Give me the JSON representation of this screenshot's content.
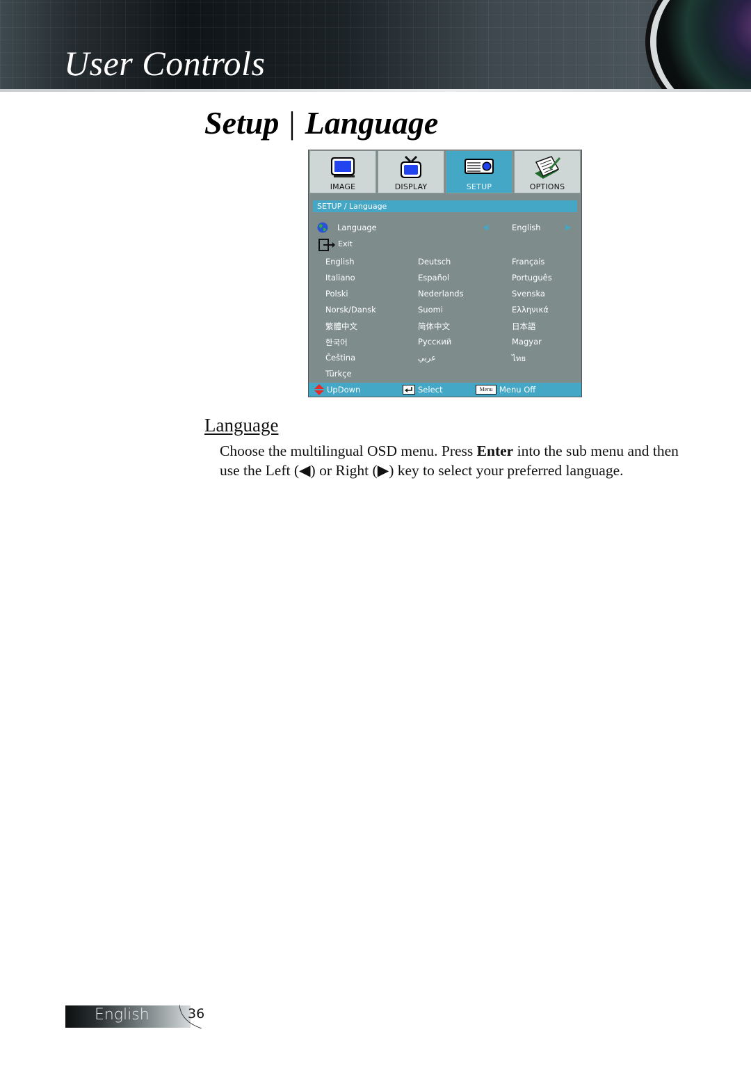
{
  "header": {
    "title": "User Controls"
  },
  "section": {
    "title_left": "Setup",
    "separator": "|",
    "title_right": "Language"
  },
  "osd": {
    "tabs": [
      {
        "label": "IMAGE",
        "icon": "image-monitor-icon",
        "active": false
      },
      {
        "label": "DISPLAY",
        "icon": "tv-icon",
        "active": false
      },
      {
        "label": "SETUP",
        "icon": "projector-icon",
        "active": true
      },
      {
        "label": "OPTIONS",
        "icon": "notepad-icon",
        "active": false
      }
    ],
    "path": "SETUP / Language",
    "language_row": {
      "label": "Language",
      "icon": "globe-icon",
      "value": "English",
      "left_arrow": "◀",
      "right_arrow": "▶"
    },
    "exit_row": {
      "label": "Exit",
      "icon": "exit-icon"
    },
    "languages": [
      [
        "English",
        "Deutsch",
        "Français"
      ],
      [
        "Italiano",
        "Español",
        "Português"
      ],
      [
        "Polski",
        "Nederlands",
        "Svenska"
      ],
      [
        "Norsk/Dansk",
        "Suomi",
        "Ελληνικά"
      ],
      [
        "繁體中文",
        "简体中文",
        "日本語"
      ],
      [
        "한국어",
        "Русский",
        "Magyar"
      ],
      [
        "Čeština",
        "عربي",
        "ไทย"
      ],
      [
        "Türkçe",
        "",
        ""
      ]
    ],
    "status_bar": {
      "updown_label": "UpDown",
      "select_label": "Select",
      "menu_key": "Menu",
      "menuoff_label": "Menu Off"
    },
    "colors": {
      "accent": "#44a7c6",
      "panel": "#7f8c8c",
      "tab": "#cfd6d6"
    }
  },
  "content": {
    "heading": "Language",
    "paragraph_part1": "Choose the multilingual OSD menu. Press ",
    "paragraph_bold": "Enter",
    "paragraph_part2": " into the sub menu and then use the Left (◀) or Right (▶) key to select your preferred language."
  },
  "footer": {
    "language": "English",
    "page_number": "36"
  }
}
